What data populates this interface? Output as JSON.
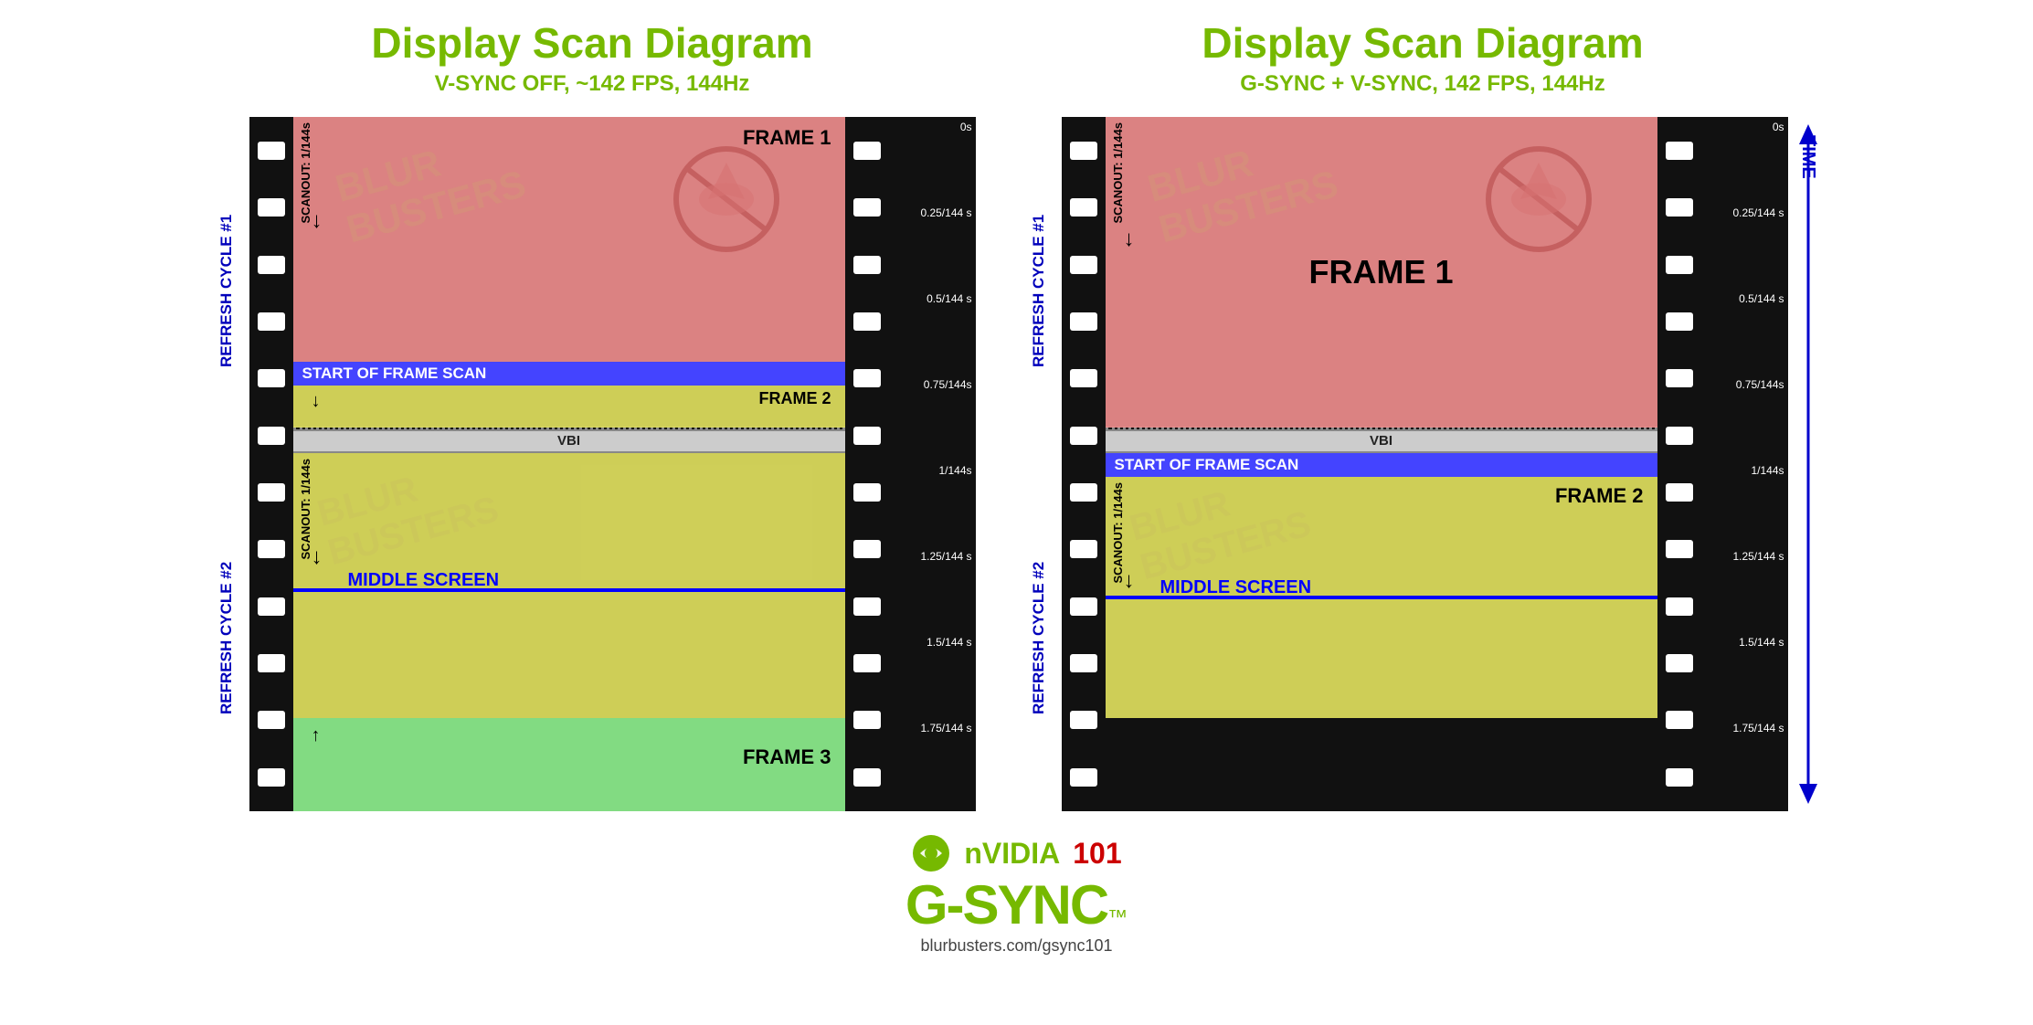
{
  "left_diagram": {
    "title": "Display Scan Diagram",
    "subtitle": "V-SYNC OFF, ~142 FPS, 144Hz",
    "cycle1": {
      "label": "REFRESH CYCLE #1",
      "frame1_label": "FRAME 1",
      "frame2_label": "FRAME 2",
      "scanout_label": "SCANOUT: 1/144s",
      "start_frame_scan": "START OF FRAME SCAN"
    },
    "cycle2": {
      "label": "REFRESH CYCLE #2",
      "frame3_label": "FRAME 3",
      "scanout_label": "SCANOUT: 1/144s",
      "middle_screen": "MIDDLE SCREEN"
    },
    "vbi_label": "VBI"
  },
  "right_diagram": {
    "title": "Display Scan Diagram",
    "subtitle": "G-SYNC + V-SYNC, 142 FPS, 144Hz",
    "cycle1": {
      "label": "REFRESH CYCLE #1",
      "frame1_label": "FRAME 1",
      "scanout_label": "SCANOUT: 1/144s"
    },
    "cycle2": {
      "label": "REFRESH CYCLE #2",
      "frame2_label": "FRAME 2",
      "scanout_label": "SCANOUT: 1/144s",
      "start_frame_scan": "START OF FRAME SCAN",
      "middle_screen": "MIDDLE SCREEN"
    },
    "vbi_label": "VBI"
  },
  "time_labels": [
    "0s",
    "0.25/144 s",
    "0.5/144 s",
    "0.75/144s",
    "1/144s",
    "1.25/144 s",
    "1.5/144 s",
    "1.75/144 s",
    ""
  ],
  "time_label": "TIME",
  "footer": {
    "nvidia_label": "nVIDIA",
    "blurbusters_label": "101",
    "gsync_label": "G-SYNC",
    "tm": "™",
    "url": "blurbusters.com/gsync101"
  },
  "watermark": "BLUR\nBUSTERS"
}
